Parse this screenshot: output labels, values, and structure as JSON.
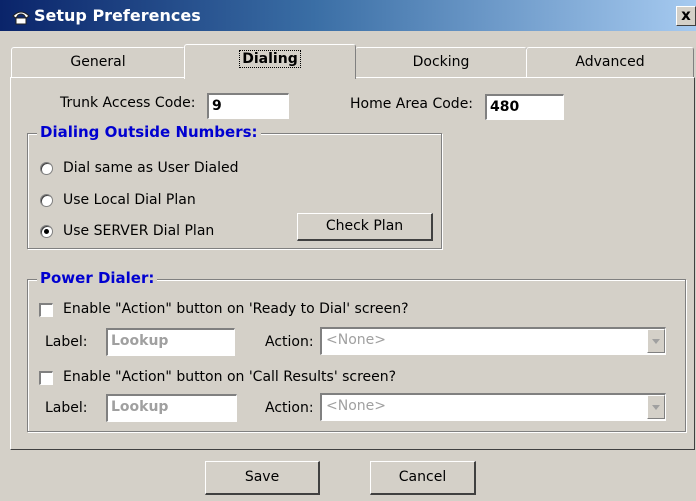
{
  "window": {
    "title": "Setup Preferences",
    "close_label": "x"
  },
  "tabs": [
    {
      "label": "General"
    },
    {
      "label": "Dialing"
    },
    {
      "label": "Docking"
    },
    {
      "label": "Advanced"
    }
  ],
  "trunk": {
    "label": "Trunk Access Code:",
    "value": "9"
  },
  "home_area": {
    "label": "Home Area Code:",
    "value": "480"
  },
  "dialing_group": {
    "title": "Dialing Outside Numbers:",
    "options": [
      {
        "label": "Dial same as User Dialed",
        "selected": false
      },
      {
        "label": "Use Local Dial Plan",
        "selected": false
      },
      {
        "label": "Use SERVER Dial Plan",
        "selected": true
      }
    ],
    "check_plan_label": "Check Plan"
  },
  "power_group": {
    "title": "Power Dialer:",
    "rows": [
      {
        "checkbox_label": "Enable \"Action\" button on 'Ready to Dial' screen?",
        "checked": false,
        "label_caption": "Label:",
        "label_value": "Lookup",
        "action_caption": "Action:",
        "action_value": "<None>"
      },
      {
        "checkbox_label": "Enable \"Action\" button on 'Call Results' screen?",
        "checked": false,
        "label_caption": "Label:",
        "label_value": "Lookup",
        "action_caption": "Action:",
        "action_value": "<None>"
      }
    ]
  },
  "buttons": {
    "save": "Save",
    "cancel": "Cancel"
  },
  "colors": {
    "title_start": "#0a246a",
    "title_end": "#a6caf0",
    "group_title": "#0000d0",
    "face": "#d4d0c8"
  }
}
